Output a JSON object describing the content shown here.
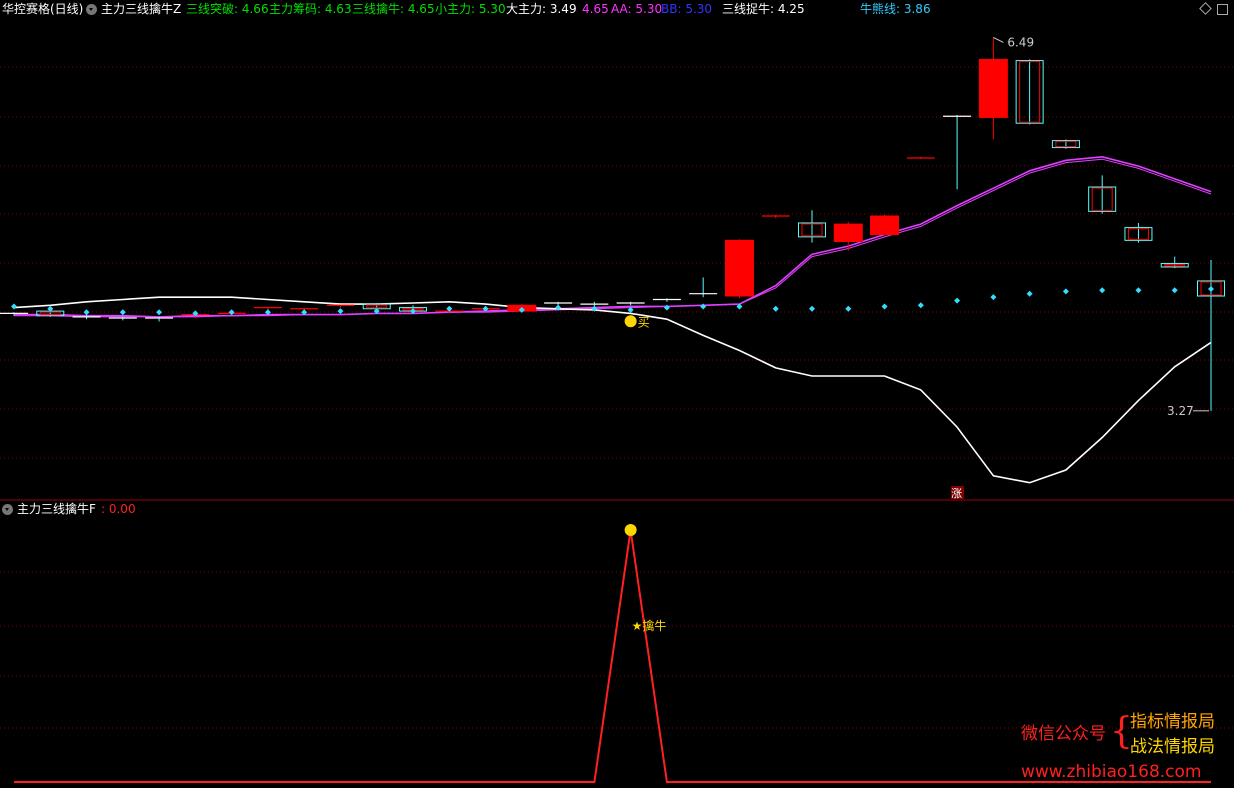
{
  "header": {
    "stock_name": "华控赛格(日线)",
    "indicator_name": "主力三线擒牛Z",
    "items": [
      {
        "label": "三线突破: 4.66",
        "color": "#00e000"
      },
      {
        "label": "主力筹码: 4.63",
        "color": "#00e000"
      },
      {
        "label": "三线擒牛: 4.65",
        "color": "#00e000"
      },
      {
        "label": "小主力: 5.30",
        "color": "#00e000"
      },
      {
        "label": "大主力: 3.49",
        "color": "#ffffff"
      },
      {
        "label": "4.65",
        "color": "#ff33ff"
      },
      {
        "label": "AA: 5.30",
        "color": "#ff33ff"
      },
      {
        "label": "BB: 5.30",
        "color": "#3333ff"
      },
      {
        "label": "三线捉牛: 4.25",
        "color": "#ffffff"
      },
      {
        "label": "牛熊线: 3.86",
        "color": "#33ccff"
      }
    ]
  },
  "sub_header": {
    "indicator_name": "主力三线擒牛F",
    "value": ": 0.00"
  },
  "annotations": {
    "high_label": "6.49",
    "low_label": "3.27",
    "buy_label": "买",
    "zhang_label": "涨",
    "qinniu_label": "★擒牛"
  },
  "watermark": {
    "left_text": "微信公众号",
    "line1": "指标情报局",
    "line2": "战法情报局",
    "url": "www.zhibiao168.com"
  },
  "colors": {
    "up": "#ff0000",
    "down": "#54ffff",
    "ma_magenta": "#e040ff",
    "white_line": "#ffffff",
    "dots": "#33ddff",
    "grid": "#800000",
    "signal": "#ff2020",
    "gold": "#ffd700"
  },
  "chart_data": [
    {
      "type": "candlestick",
      "title": "主力三线擒牛Z",
      "candles": [
        {
          "o": 4.11,
          "h": 4.12,
          "l": 4.09,
          "c": 4.1
        },
        {
          "o": 4.13,
          "h": 4.15,
          "l": 4.08,
          "c": 4.09
        },
        {
          "o": 4.08,
          "h": 4.1,
          "l": 4.06,
          "c": 4.07
        },
        {
          "o": 4.07,
          "h": 4.08,
          "l": 4.05,
          "c": 4.06
        },
        {
          "o": 4.07,
          "h": 4.08,
          "l": 4.04,
          "c": 4.06
        },
        {
          "o": 4.09,
          "h": 4.11,
          "l": 4.07,
          "c": 4.1
        },
        {
          "o": 4.11,
          "h": 4.12,
          "l": 4.1,
          "c": 4.11
        },
        {
          "o": 4.15,
          "h": 4.16,
          "l": 4.14,
          "c": 4.16
        },
        {
          "o": 4.15,
          "h": 4.16,
          "l": 4.14,
          "c": 4.15
        },
        {
          "o": 4.17,
          "h": 4.18,
          "l": 4.16,
          "c": 4.18
        },
        {
          "o": 4.19,
          "h": 4.2,
          "l": 4.14,
          "c": 4.15
        },
        {
          "o": 4.16,
          "h": 4.18,
          "l": 4.12,
          "c": 4.13
        },
        {
          "o": 4.12,
          "h": 4.14,
          "l": 4.11,
          "c": 4.13
        },
        {
          "o": 4.14,
          "h": 4.16,
          "l": 4.12,
          "c": 4.15
        },
        {
          "o": 4.13,
          "h": 4.19,
          "l": 4.12,
          "c": 4.18
        },
        {
          "o": 4.2,
          "h": 4.21,
          "l": 4.18,
          "c": 4.19
        },
        {
          "o": 4.19,
          "h": 4.21,
          "l": 4.17,
          "c": 4.18
        },
        {
          "o": 4.2,
          "h": 4.21,
          "l": 4.18,
          "c": 4.19
        },
        {
          "o": 4.23,
          "h": 4.24,
          "l": 4.21,
          "c": 4.22
        },
        {
          "o": 4.28,
          "h": 4.42,
          "l": 4.25,
          "c": 4.27
        },
        {
          "o": 4.26,
          "h": 4.75,
          "l": 4.24,
          "c": 4.74
        },
        {
          "o": 4.94,
          "h": 4.96,
          "l": 4.93,
          "c": 4.95
        },
        {
          "o": 4.89,
          "h": 5.0,
          "l": 4.72,
          "c": 4.77
        },
        {
          "o": 4.73,
          "h": 4.9,
          "l": 4.65,
          "c": 4.88
        },
        {
          "o": 4.79,
          "h": 4.96,
          "l": 4.78,
          "c": 4.95
        },
        {
          "o": 5.45,
          "h": 5.46,
          "l": 5.44,
          "c": 5.45
        },
        {
          "o": 5.81,
          "h": 5.82,
          "l": 5.18,
          "c": 5.8
        },
        {
          "o": 5.8,
          "h": 6.49,
          "l": 5.61,
          "c": 6.3
        },
        {
          "o": 6.29,
          "h": 6.3,
          "l": 5.74,
          "c": 5.75
        },
        {
          "o": 5.6,
          "h": 5.61,
          "l": 5.53,
          "c": 5.54
        },
        {
          "o": 5.2,
          "h": 5.3,
          "l": 4.97,
          "c": 4.99
        },
        {
          "o": 4.85,
          "h": 4.89,
          "l": 4.72,
          "c": 4.74
        },
        {
          "o": 4.54,
          "h": 4.6,
          "l": 4.5,
          "c": 4.51
        },
        {
          "o": 4.39,
          "h": 4.57,
          "l": 3.27,
          "c": 4.26
        }
      ],
      "series": [
        {
          "name": "AA",
          "values": [
            4.1,
            4.1,
            4.09,
            4.09,
            4.08,
            4.09,
            4.09,
            4.1,
            4.1,
            4.1,
            4.11,
            4.11,
            4.12,
            4.13,
            4.14,
            4.15,
            4.16,
            4.17,
            4.17,
            4.18,
            4.19,
            4.35,
            4.62,
            4.69,
            4.79,
            4.88,
            5.04,
            5.19,
            5.34,
            5.43,
            5.46,
            5.38,
            5.27,
            5.16,
            5.1
          ]
        },
        {
          "name": "BB",
          "values": [
            4.09,
            4.09,
            4.08,
            4.08,
            4.08,
            4.08,
            4.09,
            4.09,
            4.1,
            4.1,
            4.11,
            4.11,
            4.12,
            4.12,
            4.13,
            4.14,
            4.15,
            4.16,
            4.17,
            4.18,
            4.19,
            4.33,
            4.6,
            4.67,
            4.77,
            4.86,
            5.02,
            5.17,
            5.32,
            5.41,
            5.44,
            5.36,
            5.25,
            5.14,
            5.08
          ]
        },
        {
          "name": "三线捉牛",
          "values": [
            4.16,
            4.18,
            4.21,
            4.23,
            4.25,
            4.25,
            4.25,
            4.23,
            4.21,
            4.19,
            4.19,
            4.2,
            4.21,
            4.19,
            4.16,
            4.15,
            4.14,
            4.11,
            4.06,
            3.92,
            3.79,
            3.64,
            3.57,
            3.57,
            3.57,
            3.45,
            3.13,
            2.71,
            2.65,
            2.76,
            3.04,
            3.36,
            3.65,
            3.86
          ]
        },
        {
          "name": "牛熊线",
          "values": [
            4.17,
            4.15,
            4.12,
            4.12,
            4.12,
            4.11,
            4.12,
            4.12,
            4.12,
            4.13,
            4.13,
            4.13,
            4.15,
            4.15,
            4.14,
            4.16,
            4.15,
            4.14,
            4.16,
            4.17,
            4.17,
            4.15,
            4.15,
            4.15,
            4.17,
            4.18,
            4.22,
            4.25,
            4.28,
            4.3,
            4.31,
            4.31,
            4.31,
            4.32
          ]
        }
      ],
      "ylim": [
        2.57,
        6.64
      ]
    },
    {
      "type": "line",
      "title": "主力三线擒牛F",
      "series": [
        {
          "name": "主力三线擒牛F",
          "values": [
            0,
            0,
            0,
            0,
            0,
            0,
            0,
            0,
            0,
            0,
            0,
            0,
            0,
            0,
            0,
            0,
            0,
            1,
            0,
            0,
            0,
            0,
            0,
            0,
            0,
            0,
            0,
            0,
            0,
            0,
            0,
            0,
            0,
            0
          ]
        }
      ],
      "ylim": [
        0,
        1
      ]
    }
  ]
}
